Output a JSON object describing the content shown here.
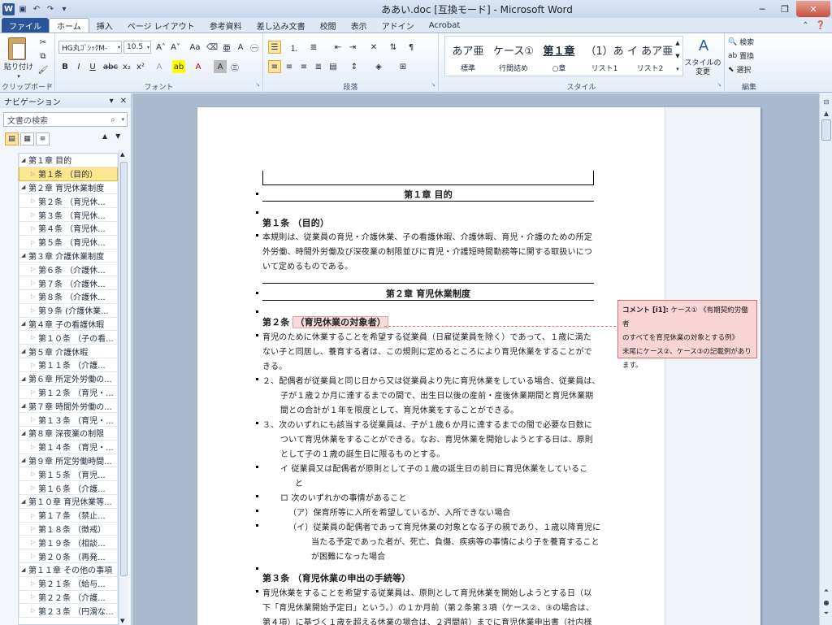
{
  "window": {
    "title": "ああい.doc [互換モード] - Microsoft Word",
    "app_badge": "W",
    "quick_access": [
      "save-icon",
      "undo-icon",
      "redo-icon",
      "customize-icon"
    ],
    "controls": [
      "minimize",
      "restore",
      "close"
    ]
  },
  "tabs": [
    "ファイル",
    "ホーム",
    "挿入",
    "ページ レイアウト",
    "参考資料",
    "差し込み文書",
    "校閲",
    "表示",
    "アドイン",
    "Acrobat"
  ],
  "active_tab": "ホーム",
  "ribbon": {
    "clipboard": {
      "label": "クリップボード",
      "paste": "貼り付け"
    },
    "font": {
      "label": "フォント",
      "font_name": "HG丸ｺﾞｼｯｸM-",
      "font_size": "10.5"
    },
    "paragraph": {
      "label": "段落"
    },
    "styles": {
      "label": "スタイル",
      "items": [
        {
          "sample": "あア亜",
          "name": "標準"
        },
        {
          "sample": "ケース①",
          "name": "行間詰め"
        },
        {
          "sample": "第１章",
          "name": "○章"
        },
        {
          "sample": "（1）あ",
          "name": "リスト1"
        },
        {
          "sample": "イ あア亜",
          "name": "リスト2"
        }
      ],
      "change_styles": "スタイルの変更"
    },
    "editing": {
      "label": "編集",
      "find": "検索",
      "replace": "置換",
      "select": "選択"
    }
  },
  "nav": {
    "title": "ナビゲーション",
    "search_placeholder": "文書の検索",
    "items": [
      {
        "text": "第１章 目的",
        "level": 1
      },
      {
        "text": "第１条 （目的）",
        "level": 2,
        "selected": true
      },
      {
        "text": "第２章 育児休業制度",
        "level": 1
      },
      {
        "text": "第２条 （育児休...",
        "level": 2
      },
      {
        "text": "第３条 （育児休...",
        "level": 2
      },
      {
        "text": "第４条 （育児休...",
        "level": 2
      },
      {
        "text": "第５条 （育児休...",
        "level": 2
      },
      {
        "text": "第３章 介護休業制度",
        "level": 1
      },
      {
        "text": "第６条 （介護休...",
        "level": 2
      },
      {
        "text": "第７条 （介護休...",
        "level": 2
      },
      {
        "text": "第８条 （介護休...",
        "level": 2
      },
      {
        "text": "第９条 (介護休業...",
        "level": 2
      },
      {
        "text": "第４章 子の看護休暇",
        "level": 1
      },
      {
        "text": "第１０条 （子の看...",
        "level": 2
      },
      {
        "text": "第５章 介護休暇",
        "level": 1
      },
      {
        "text": "第１１条 （介護...",
        "level": 2
      },
      {
        "text": "第６章 所定外労働の...",
        "level": 1
      },
      {
        "text": "第１２条 （育児・...",
        "level": 2
      },
      {
        "text": "第７章 時間外労働の...",
        "level": 1
      },
      {
        "text": "第１３条 （育児・...",
        "level": 2
      },
      {
        "text": "第８章 深夜業の制限",
        "level": 1
      },
      {
        "text": "第１４条 （育児・...",
        "level": 2
      },
      {
        "text": "第９章 所定労働時間...",
        "level": 1
      },
      {
        "text": "第１５条 （育児...",
        "level": 2
      },
      {
        "text": "第１６条 （介護...",
        "level": 2
      },
      {
        "text": "第１０章 育児休業等...",
        "level": 1
      },
      {
        "text": "第１７条 （禁止...",
        "level": 2
      },
      {
        "text": "第１８条 （徴戒）",
        "level": 2
      },
      {
        "text": "第１９条 （相談...",
        "level": 2
      },
      {
        "text": "第２０条 （再発...",
        "level": 2
      },
      {
        "text": "第１１章 その他の事項",
        "level": 1
      },
      {
        "text": "第２１条 （給与...",
        "level": 2
      },
      {
        "text": "第２２条 （介護...",
        "level": 2
      },
      {
        "text": "第２３条 （円滑な...",
        "level": 2
      }
    ]
  },
  "document": {
    "chapter1": "第１章 目的",
    "art1_heading": "第１条 （目的）",
    "art1_lines": [
      "本規則は、従業員の育児・介護休業、子の看護休暇、介護休暇、育児・介護のための所定",
      "外労働、時間外労働及び深夜業の制限並びに育児・介護短時間勤務等に関する取扱いにつ",
      "いて定めるものである。"
    ],
    "chapter2": "第２章 育児休業制度",
    "art2_prefix": "第２条",
    "art2_title": "（育児休業の対象者）",
    "art2_p1": [
      "育児のために休業することを希望する従業員（日雇従業員を除く）であって、１歳に満た",
      "ない子と同居し、養育する者は、この規則に定めるところにより育児休業をすることがで",
      "きる。"
    ],
    "art2_p2": [
      "２、配偶者が従業員と同じ日から又は従業員より先に育児休業をしている場合、従業員は、",
      "子が１歳２か月に達するまでの間で、出生日以後の産前・産後休業期間と育児休業期",
      "間との合計が１年を限度として、育児休業をすることができる。"
    ],
    "art2_p3": [
      "３、次のいずれにも該当する従業員は、子が１歳６か月に達するまでの間で必要な日数に",
      "ついて育児休業をすることができる。なお、育児休業を開始しようとする日は、原則",
      "として子の１歳の誕生日に限るものとする。"
    ],
    "item_i": [
      "イ 従業員又は配偶者が原則として子の１歳の誕生日の前日に育児休業をしているこ",
      "と"
    ],
    "item_ro": "ロ 次のいずれかの事情があること",
    "item_a": "（ア）保育所等に入所を希望しているが、入所できない場合",
    "item_b": [
      "（イ）従業員の配偶者であって育児休業の対象となる子の親であり、１歳以降育児に",
      "当たる予定であった者が、死亡、負傷、疾病等の事情により子を養育すること",
      "が困難になった場合"
    ],
    "art3_heading": "第３条 （育児休業の申出の手続等）",
    "art3_lines": [
      "育児休業をすることを希望する従業員は、原則として育児休業を開始しようとする日（以",
      "下「育児休業開始予定日」という。）の１か月前（第２条第３項（ケース②、③の場合は、",
      "第４項）に基づく１歳を超える休業の場合は、２週間前）までに育児休業申出書（社内様"
    ]
  },
  "comment": {
    "author": "コメント [i1]:",
    "lines": [
      "ケース① 《有期契約労働者",
      "のすべてを育児休業の対象とする例》",
      "末尾にケース②、ケース③の記載例があり",
      "ます。"
    ]
  }
}
